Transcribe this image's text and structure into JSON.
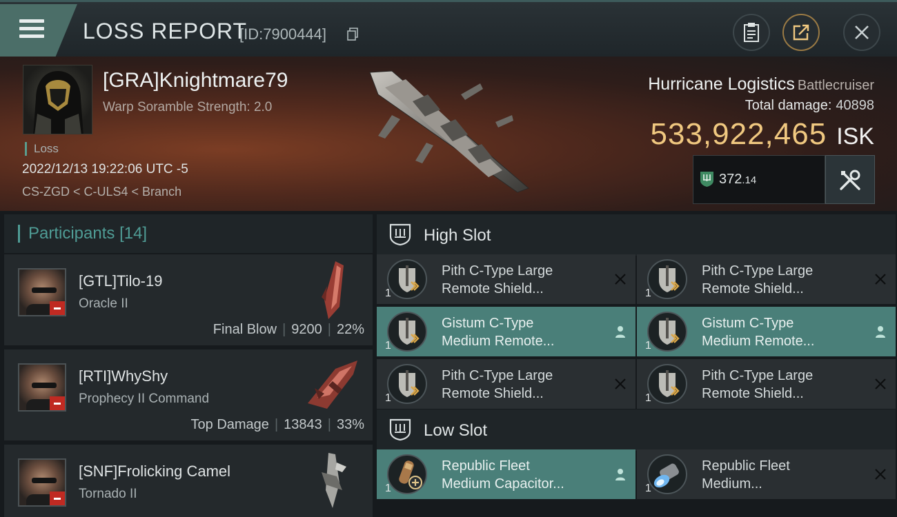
{
  "header": {
    "title": "LOSS REPORT",
    "report_id": "[ID:7900444]"
  },
  "victim": {
    "name": "[GRA]Knightmare79",
    "warp_scramble": "Warp Soramble Strength: 2.0",
    "status": "Loss",
    "datetime": "2022/12/13 19:22:06 UTC -5",
    "location": "CS-ZGD < C-ULS4 < Branch",
    "ship_name": "Hurricane Logistics",
    "ship_class": "Battlecruiser",
    "total_damage_label": "Total damage:",
    "total_damage": "40898",
    "isk_value": "533,922,465",
    "isk_unit": "ISK",
    "shield_value": "372",
    "shield_decimal": ".14"
  },
  "participants": {
    "label": "Participants",
    "count": "[14]",
    "items": [
      {
        "name": "[GTL]Tilo-19",
        "ship": "Oracle II",
        "role": "Final Blow",
        "damage": "9200",
        "percent": "22%"
      },
      {
        "name": "[RTI]WhyShy",
        "ship": "Prophecy II Command",
        "role": "Top Damage",
        "damage": "13843",
        "percent": "33%"
      },
      {
        "name": "[SNF]Frolicking Camel",
        "ship": "Tornado II",
        "role": "",
        "damage": "",
        "percent": ""
      }
    ]
  },
  "high_slot": {
    "label": "High Slot",
    "items": [
      {
        "qty": "1",
        "line1": "Pith C-Type Large",
        "line2": "Remote Shield...",
        "state": "destroyed"
      },
      {
        "qty": "1",
        "line1": "Pith C-Type Large",
        "line2": "Remote Shield...",
        "state": "destroyed"
      },
      {
        "qty": "1",
        "line1": "Gistum C-Type",
        "line2": "Medium Remote...",
        "state": "dropped"
      },
      {
        "qty": "1",
        "line1": "Gistum C-Type",
        "line2": "Medium Remote...",
        "state": "dropped"
      },
      {
        "qty": "1",
        "line1": "Pith C-Type Large",
        "line2": "Remote Shield...",
        "state": "destroyed"
      },
      {
        "qty": "1",
        "line1": "Pith C-Type Large",
        "line2": "Remote Shield...",
        "state": "destroyed"
      }
    ]
  },
  "low_slot": {
    "label": "Low Slot",
    "items": [
      {
        "qty": "1",
        "line1": "Republic Fleet",
        "line2": "Medium Capacitor...",
        "state": "dropped"
      },
      {
        "qty": "1",
        "line1": "Republic Fleet",
        "line2": "Medium...",
        "state": "destroyed"
      }
    ]
  },
  "colors": {
    "accent_teal": "#4f9c95",
    "isk_gold": "#f0c880",
    "dropped_bg": "#4a7f79",
    "loss_red": "#c02a22"
  }
}
